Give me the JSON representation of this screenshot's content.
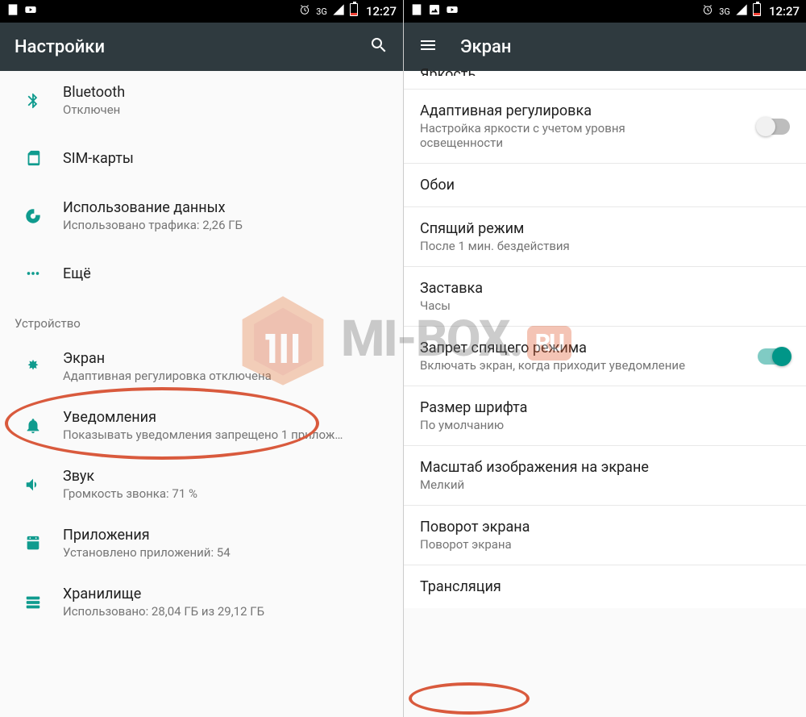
{
  "statusbar": {
    "time": "12:27",
    "network_label": "3G"
  },
  "left": {
    "appbar": {
      "title": "Настройки"
    },
    "items": {
      "bluetooth": {
        "label": "Bluetooth",
        "sub": "Отключен"
      },
      "sim": {
        "label": "SIM-карты"
      },
      "data": {
        "label": "Использование данных",
        "sub": "Использовано трафика: 2,26 ГБ"
      },
      "more": {
        "label": "Ещё"
      }
    },
    "category": "Устройство",
    "device": {
      "display": {
        "label": "Экран",
        "sub": "Адаптивная регулировка отключена"
      },
      "notifications": {
        "label": "Уведомления",
        "sub": "Показывать уведомления запрещено 1 прилож…"
      },
      "sound": {
        "label": "Звук",
        "sub": "Громкость звонка: 71 %"
      },
      "apps": {
        "label": "Приложения",
        "sub": "Установлено приложений: 54"
      },
      "storage": {
        "label": "Хранилище",
        "sub": "Использовано: 28,04 ГБ из 29,12 ГБ"
      }
    }
  },
  "right": {
    "appbar": {
      "title": "Экран"
    },
    "partial_top": "Яркость",
    "items": {
      "adaptive": {
        "label": "Адаптивная регулировка",
        "sub": "Настройка яркости с учетом уровня освещенности"
      },
      "wallpaper": {
        "label": "Обои"
      },
      "sleep": {
        "label": "Спящий режим",
        "sub": "После 1 мин. бездействия"
      },
      "screensaver": {
        "label": "Заставка",
        "sub": "Часы"
      },
      "stay_awake": {
        "label": "Запрет спящего режима",
        "sub": "Включать экран, когда приходит уведомление"
      },
      "font_size": {
        "label": "Размер шрифта",
        "sub": "По умолчанию"
      },
      "display_size": {
        "label": "Масштаб изображения на экране",
        "sub": "Мелкий"
      },
      "rotation": {
        "label": "Поворот экрана",
        "sub": "Поворот экрана"
      },
      "cast": {
        "label": "Трансляция"
      }
    }
  },
  "watermark": {
    "text": "MI-BOX",
    "tld": "RU"
  }
}
